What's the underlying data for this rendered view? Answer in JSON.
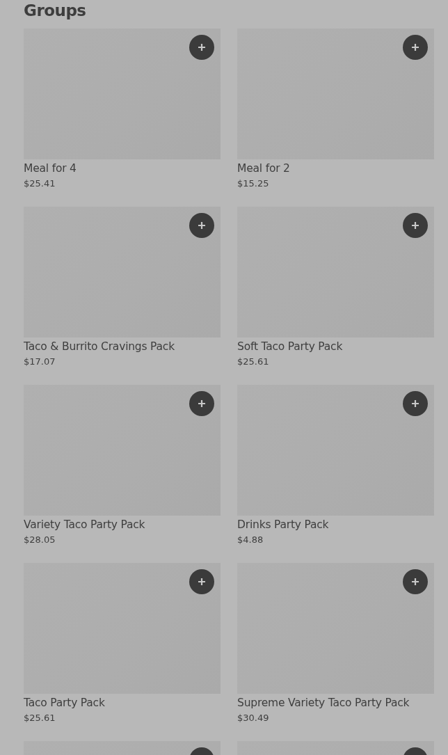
{
  "section": {
    "title": "Groups"
  },
  "items": [
    {
      "kind": "card",
      "name": "Meal for 4",
      "price": "$25.41"
    },
    {
      "kind": "card",
      "name": "Meal for 2",
      "price": "$15.25"
    },
    {
      "kind": "card",
      "name": "Taco & Burrito Cravings Pack",
      "price": "$17.07"
    },
    {
      "kind": "card",
      "name": "Soft Taco Party Pack",
      "price": "$25.61"
    },
    {
      "kind": "card",
      "name": "Variety Taco Party Pack",
      "price": "$28.05"
    },
    {
      "kind": "card",
      "name": "Drinks Party Pack",
      "price": "$4.88"
    },
    {
      "kind": "card",
      "name": "Taco Party Pack",
      "price": "$25.61"
    },
    {
      "kind": "card",
      "name": "Supreme Variety Taco Party Pack",
      "price": "$30.49"
    },
    {
      "kind": "cut"
    },
    {
      "kind": "cut"
    }
  ]
}
